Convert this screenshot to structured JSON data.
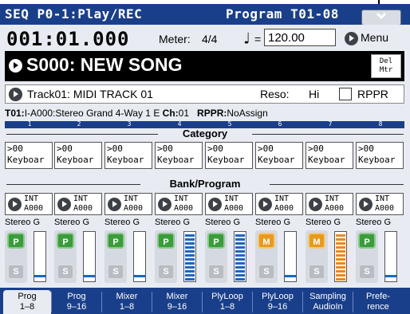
{
  "header": {
    "page_title": "SEQ P0-1:Play/REC",
    "section_title": "Program T01-08"
  },
  "transport": {
    "location": "001:01.000",
    "meter_label": "Meter:",
    "meter_value": "4/4",
    "tempo_symbol": "♩",
    "tempo_eq": "=",
    "tempo_value": "120.00",
    "menu_label": "Menu"
  },
  "song": {
    "name": "S000: NEW SONG",
    "del_mtr_line1": "Del",
    "del_mtr_line2": "Mtr"
  },
  "track": {
    "label": "Track01: MIDI TRACK 01",
    "reso_label": "Reso:",
    "reso_value": "Hi",
    "rppr_label": "RPPR"
  },
  "info": {
    "track_prefix": "T01:",
    "program_full": "I-A000:Stereo Grand 4-Way 1 E",
    "ch_label": "Ch:",
    "ch_value": "01",
    "rppr_label": "RPPR:",
    "rppr_value": "NoAssign"
  },
  "channel_numbers": [
    "1",
    "2",
    "3",
    "4",
    "5",
    "6",
    "7",
    "8"
  ],
  "category_header": "Category",
  "bank_header": "Bank/Program",
  "tracks": [
    {
      "cat_num": ">00",
      "cat_name": "Keyboar",
      "bank": "INT",
      "prog": "A000",
      "prog_name": "Stereo G",
      "play_mute": "P",
      "solo": "S",
      "level": 0.08
    },
    {
      "cat_num": ">00",
      "cat_name": "Keyboar",
      "bank": "INT",
      "prog": "A000",
      "prog_name": "Stereo G",
      "play_mute": "P",
      "solo": "S",
      "level": 0.08
    },
    {
      "cat_num": ">00",
      "cat_name": "Keyboar",
      "bank": "INT",
      "prog": "A000",
      "prog_name": "Stereo G",
      "play_mute": "P",
      "solo": "S",
      "level": 0.08
    },
    {
      "cat_num": ">00",
      "cat_name": "Keyboar",
      "bank": "INT",
      "prog": "A000",
      "prog_name": "Stereo G",
      "play_mute": "P",
      "solo": "S",
      "level": 0.98,
      "fill": "blue"
    },
    {
      "cat_num": ">00",
      "cat_name": "Keyboar",
      "bank": "INT",
      "prog": "A000",
      "prog_name": "Stereo G",
      "play_mute": "P",
      "solo": "S",
      "level": 0.98,
      "fill": "blue"
    },
    {
      "cat_num": ">00",
      "cat_name": "Keyboar",
      "bank": "INT",
      "prog": "A000",
      "prog_name": "Stereo G",
      "play_mute": "M",
      "solo": "S",
      "level": 0.08
    },
    {
      "cat_num": ">00",
      "cat_name": "Keyboar",
      "bank": "INT",
      "prog": "A000",
      "prog_name": "Stereo G",
      "play_mute": "M",
      "solo": "S",
      "level": 0.98,
      "fill": "orange"
    },
    {
      "cat_num": ">00",
      "cat_name": "Keyboar",
      "bank": "INT",
      "prog": "A000",
      "prog_name": "Stereo G",
      "play_mute": "P",
      "solo": "S",
      "level": 0.08
    }
  ],
  "tabs": [
    {
      "line1": "Prog",
      "line2": "1–8",
      "active": true
    },
    {
      "line1": "Prog",
      "line2": "9–16"
    },
    {
      "line1": "Mixer",
      "line2": "1–8"
    },
    {
      "line1": "Mixer",
      "line2": "9–16"
    },
    {
      "line1": "PlyLoop",
      "line2": "1–8"
    },
    {
      "line1": "PlyLoop",
      "line2": "9–16"
    },
    {
      "line1": "Sampling",
      "line2": "AudioIn"
    },
    {
      "line1": "Prefe-",
      "line2": "rence"
    }
  ],
  "colors": {
    "header_blue": "#1a3f8a",
    "panel_bg": "#e8ecf2",
    "play_green": "#3a9c3a",
    "mute_orange": "#e89a1e",
    "meter_blue": "#1866c8"
  }
}
